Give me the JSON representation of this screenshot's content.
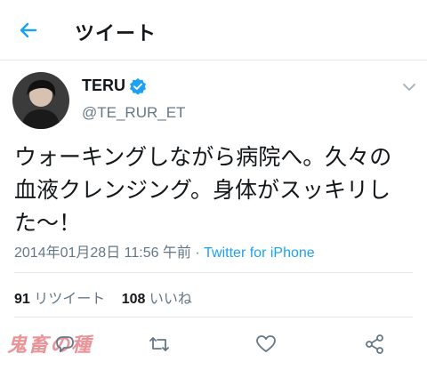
{
  "header": {
    "title": "ツイート"
  },
  "user": {
    "name": "TERU",
    "handle": "@TE_RUR_ET"
  },
  "tweet": {
    "text": "ウォーキングしながら病院へ。久々の\n血液クレンジング。身体がスッキリし\nた〜！",
    "datetime": "2014年01月28日 11:56 午前",
    "separator": " · ",
    "source": "Twitter for iPhone"
  },
  "stats": {
    "retweets_count": "91",
    "retweets_label": "リツイート",
    "likes_count": "108",
    "likes_label": "いいね"
  },
  "watermark": "鬼畜の種",
  "colors": {
    "accent": "#1da1f2",
    "muted": "#657786",
    "divider": "#e1e8ed",
    "text": "#14171a"
  },
  "icons": {
    "back": "back-arrow-icon",
    "verified": "verified-badge-icon",
    "caret": "chevron-down-icon",
    "reply": "reply-icon",
    "retweet": "retweet-icon",
    "like": "heart-icon",
    "share": "share-icon"
  }
}
